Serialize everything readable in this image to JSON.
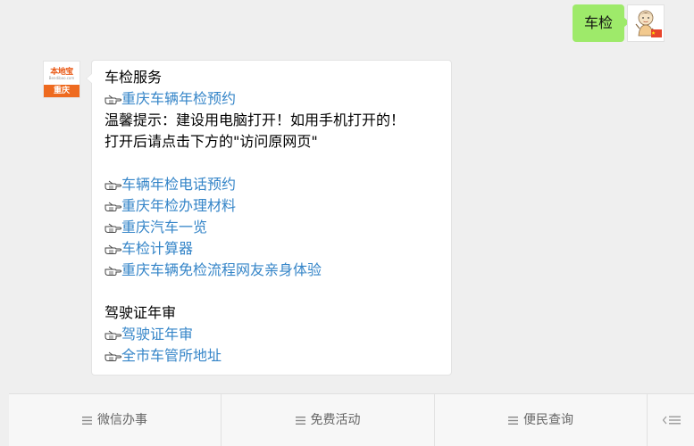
{
  "outgoing": {
    "text": "车检",
    "avatar_icon": "cartoon-user-avatar",
    "flag_icon": "red-flag-badge"
  },
  "incoming": {
    "avatar": {
      "brand": "本地宝",
      "domain": "Bendibao.com",
      "city": "重庆"
    },
    "lines": [
      {
        "text": "车检服务",
        "link": false
      },
      {
        "text": "重庆车辆年检预约",
        "link": true
      },
      {
        "text": "温馨提示：建设用电脑打开！如用手机打开的！",
        "link": false
      },
      {
        "text": "打开后请点击下方的\"访问原网页\"",
        "link": false
      },
      {
        "text": "车辆年检电话预约",
        "link": true
      },
      {
        "text": "重庆年检办理材料",
        "link": true
      },
      {
        "text": "重庆汽车一览",
        "link": true
      },
      {
        "text": "车检计算器",
        "link": true
      },
      {
        "text": "重庆车辆免检流程网友亲身体验",
        "link": true
      },
      {
        "text": "驾驶证年审",
        "link": false
      },
      {
        "text": "驾驶证年审",
        "link": true
      },
      {
        "text": "全市车管所地址",
        "link": true
      }
    ],
    "hand_icon": "pointing-hand-icon",
    "link_color": "#3585c8"
  },
  "menu": {
    "items": [
      {
        "label": "微信办事",
        "icon": "menu-lines-icon"
      },
      {
        "label": "免费活动",
        "icon": "menu-lines-icon"
      },
      {
        "label": "便民查询",
        "icon": "menu-lines-icon"
      }
    ],
    "toggle_icon": "keyboard-toggle-icon"
  },
  "colors": {
    "background": "#efefef",
    "outgoing_bubble": "#9eea6a",
    "incoming_bubble": "#ffffff",
    "brand_orange": "#ee6a1f"
  }
}
